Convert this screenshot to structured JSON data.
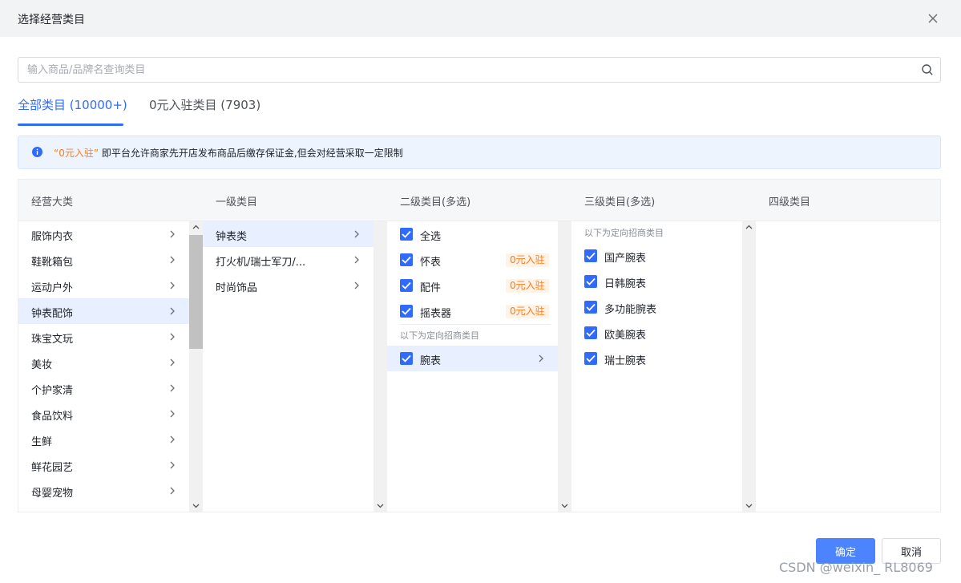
{
  "dialog": {
    "title": "选择经营类目"
  },
  "search": {
    "placeholder": "输入商品/品牌名查询类目"
  },
  "tabs": [
    {
      "label": "全部类目 (10000+)"
    },
    {
      "label": "0元入驻类目 (7903)"
    }
  ],
  "notice": {
    "highlight": "“0元入驻”",
    "text": " 即平台允许商家先开店发布商品后缴存保证金,但会对经营采取一定限制"
  },
  "columns": {
    "headers": [
      "经营大类",
      "一级类目",
      "二级类目(多选)",
      "三级类目(多选)",
      "四级类目"
    ],
    "major": [
      "服饰内衣",
      "鞋靴箱包",
      "运动户外",
      "钟表配饰",
      "珠宝文玩",
      "美妆",
      "个护家清",
      "食品饮料",
      "生鲜",
      "鲜花园艺",
      "母婴宠物"
    ],
    "level1": [
      "钟表类",
      "打火机/瑞士军刀/...",
      "时尚饰品"
    ],
    "level2": {
      "select_all": "全选",
      "items": [
        {
          "label": "怀表",
          "badge": "0元入驻"
        },
        {
          "label": "配件",
          "badge": "0元入驻"
        },
        {
          "label": "摇表器",
          "badge": "0元入驻"
        }
      ],
      "hint": "以下为定向招商类目",
      "directed": [
        "腕表"
      ]
    },
    "level3": {
      "hint": "以下为定向招商类目",
      "items": [
        "国产腕表",
        "日韩腕表",
        "多功能腕表",
        "欧美腕表",
        "瑞士腕表"
      ]
    }
  },
  "buttons": {
    "ok": "确定",
    "cancel": "取消"
  },
  "watermark": "CSDN @weixin_ RL8069",
  "colors": {
    "accent": "#2f6bff",
    "badge": "#ff7a1a",
    "selected_bg": "#e8effe"
  }
}
